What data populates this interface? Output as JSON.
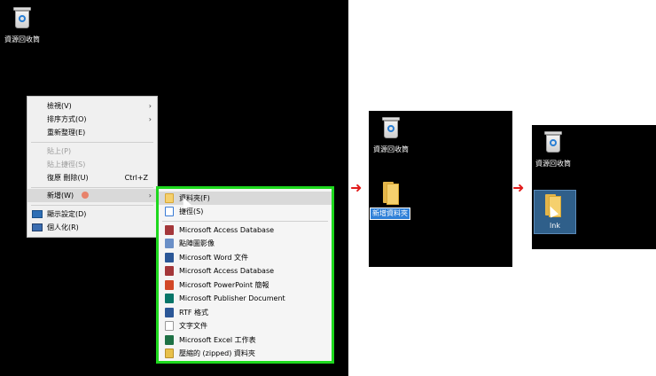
{
  "desktop": {
    "recycle_bin_label": "資源回收筒"
  },
  "context_menu": {
    "items": [
      {
        "label": "檢視(V)",
        "arrow": "›"
      },
      {
        "label": "排序方式(O)",
        "arrow": "›"
      },
      {
        "label": "重新整理(E)"
      },
      {
        "label": "貼上(P)",
        "disabled": true
      },
      {
        "label": "貼上捷徑(S)",
        "disabled": true
      },
      {
        "label": "復原 刪除(U)",
        "shortcut": "Ctrl+Z"
      },
      {
        "label": "新增(W)",
        "arrow": "›"
      },
      {
        "label": "顯示設定(D)"
      },
      {
        "label": "個人化(R)"
      }
    ]
  },
  "new_submenu": {
    "items": [
      {
        "label": "資料夾(F)",
        "icon": "folder-icon",
        "color": "#f5d06d"
      },
      {
        "label": "捷徑(S)",
        "icon": "shortcut-icon",
        "color": "#3a7bd5"
      },
      {
        "label": "Microsoft Access Database",
        "icon": "access-icon",
        "color": "#a4373a"
      },
      {
        "label": "點陣圖影像",
        "icon": "bitmap-icon",
        "color": "#6a8fc7"
      },
      {
        "label": "Microsoft Word 文件",
        "icon": "word-icon",
        "color": "#2b5797"
      },
      {
        "label": "Microsoft Access Database",
        "icon": "access-icon",
        "color": "#a4373a"
      },
      {
        "label": "Microsoft PowerPoint 簡報",
        "icon": "powerpoint-icon",
        "color": "#d24726"
      },
      {
        "label": "Microsoft Publisher Document",
        "icon": "publisher-icon",
        "color": "#077568"
      },
      {
        "label": "RTF 格式",
        "icon": "rtf-icon",
        "color": "#2b5797"
      },
      {
        "label": "文字文件",
        "icon": "text-icon",
        "color": "#dddddd"
      },
      {
        "label": "Microsoft Excel 工作表",
        "icon": "excel-icon",
        "color": "#1e7145"
      },
      {
        "label": "壓縮的 (zipped) 資料夾",
        "icon": "zip-folder-icon",
        "color": "#e8c04a"
      }
    ]
  },
  "step2": {
    "recycle_bin_label": "資源回收筒",
    "new_folder_name": "新增資料夾"
  },
  "step3": {
    "recycle_bin_label": "資源回收筒",
    "folder_name": "lnk"
  },
  "arrow_glyph": "➜",
  "colors": {
    "highlight_border": "#1ed81e",
    "arrow": "#e21b1b",
    "selection": "#2f80d8"
  }
}
